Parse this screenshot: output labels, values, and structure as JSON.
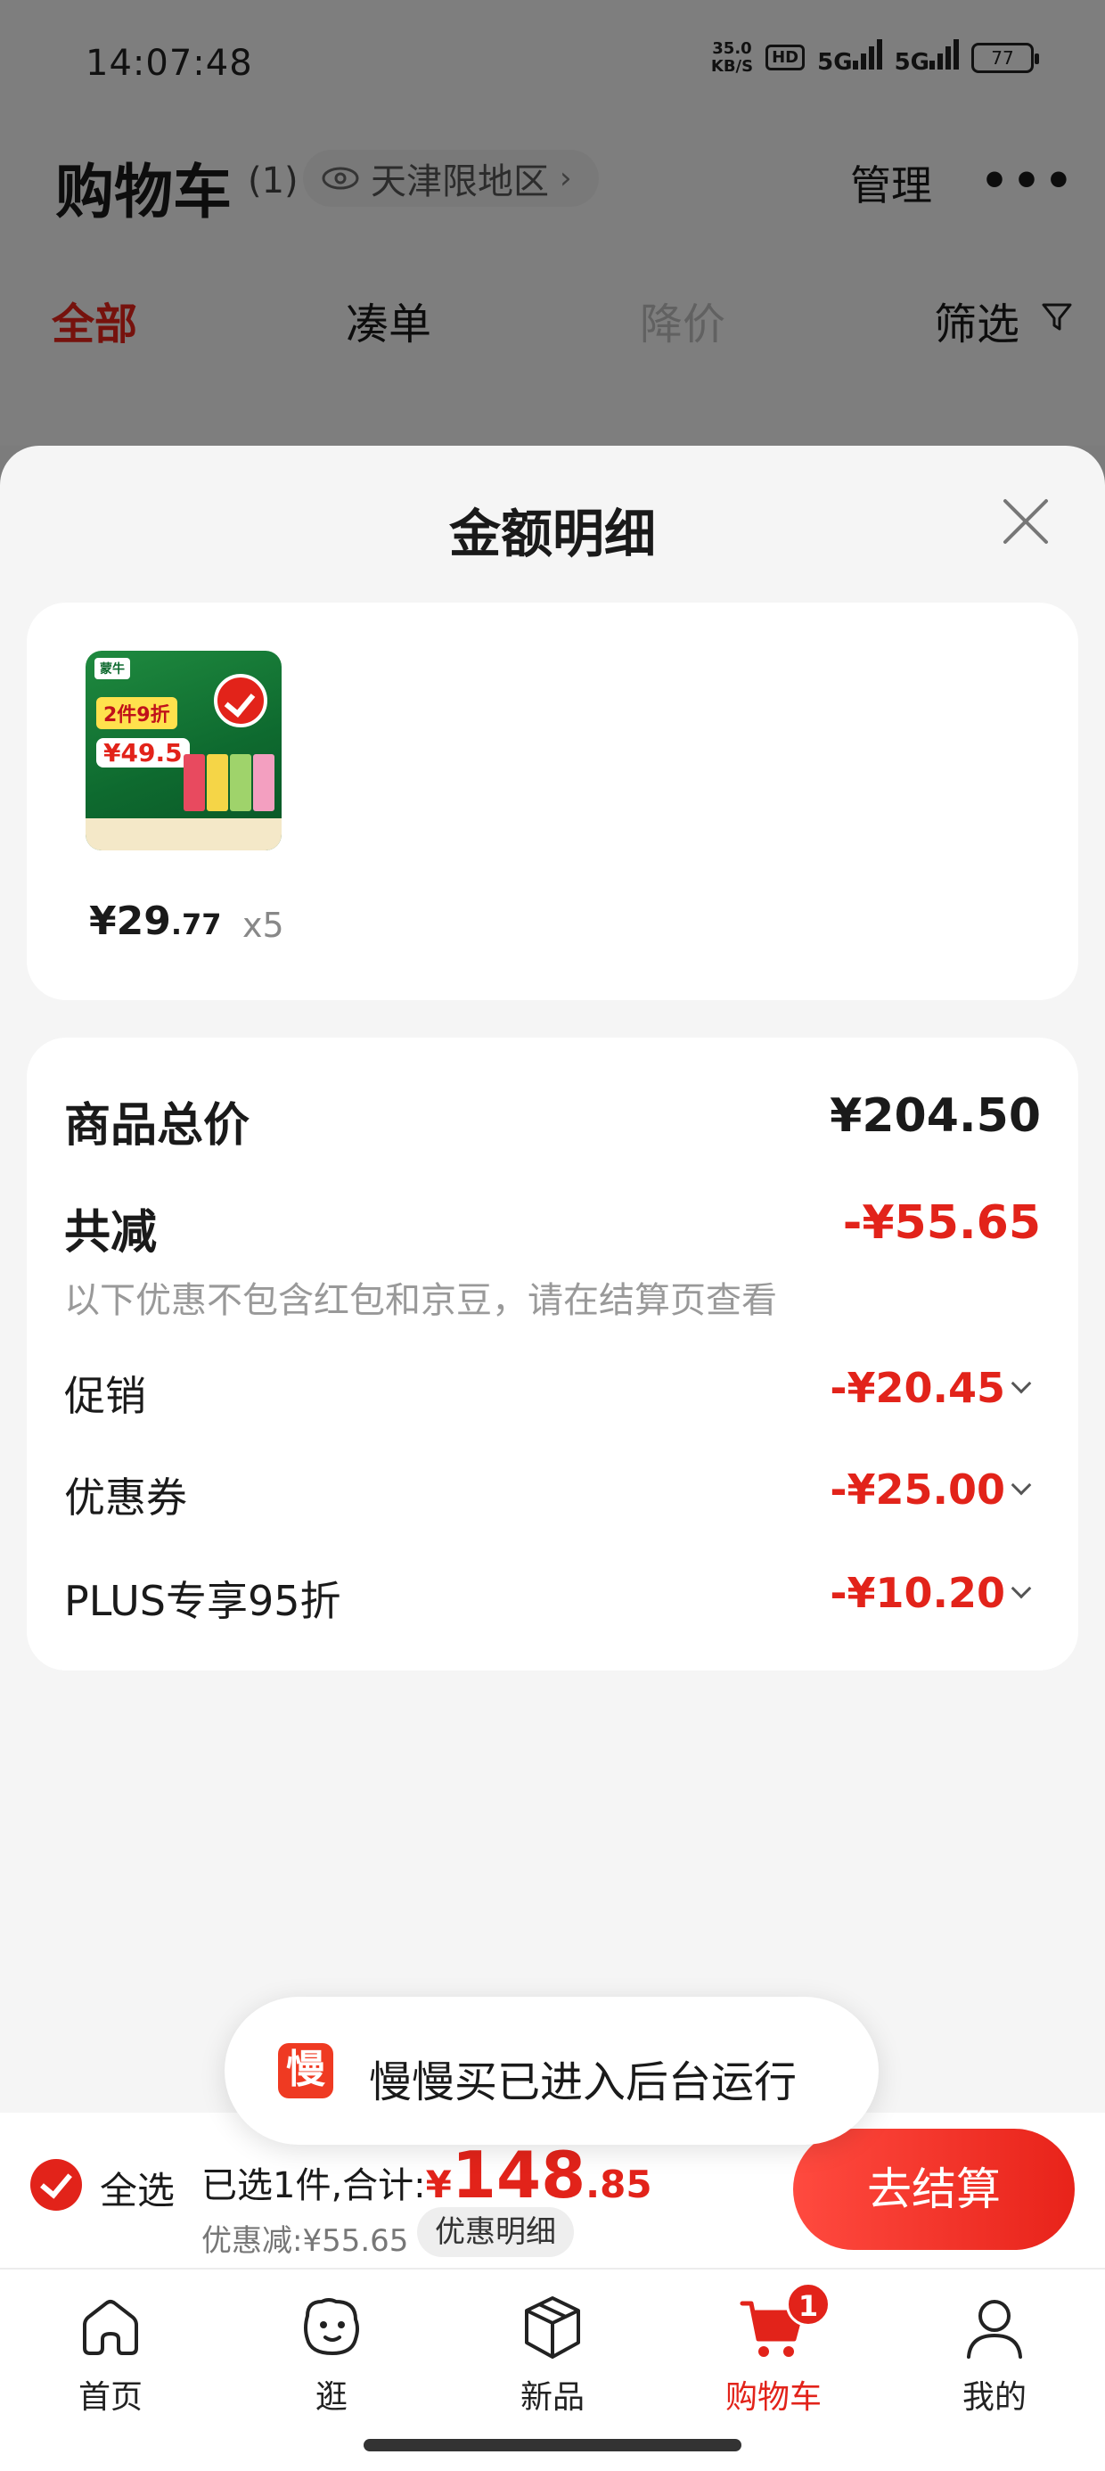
{
  "status_bar": {
    "time": "14:07:48",
    "net_speed_value": "35.0",
    "net_speed_unit": "KB/S",
    "hd_label": "HD",
    "sig1": "5G",
    "sig2": "5G",
    "battery": "77"
  },
  "cart_header": {
    "title": "购物车",
    "count": "(1)",
    "region": "天津限地区",
    "manage": "管理",
    "more": "•••"
  },
  "tabs": [
    {
      "label": "全部",
      "active": true
    },
    {
      "label": "凑单"
    },
    {
      "label": "降价"
    },
    {
      "label": "筛选"
    }
  ],
  "sheet": {
    "title": "金额明细",
    "product": {
      "image_labels": {
        "brand": "蒙牛",
        "deal": "2件9折",
        "price": "¥49.5"
      },
      "price_int": "¥29",
      "price_dec": ".77",
      "qty": "x5"
    },
    "summary": {
      "total_label": "商品总价",
      "total_value": "¥204.50",
      "reduce_label": "共减",
      "reduce_value": "-¥55.65",
      "note": "以下优惠不包含红包和京豆，请在结算页查看",
      "items": [
        {
          "label": "促销",
          "value": "-¥20.45"
        },
        {
          "label": "优惠券",
          "value": "-¥25.00"
        },
        {
          "label": "PLUS专享95折",
          "value": "-¥10.20"
        }
      ]
    }
  },
  "toast": {
    "icon_char": "慢",
    "text": "慢慢买已进入后台运行"
  },
  "checkout": {
    "select_all": "全选",
    "selected_text": "已选1件,合计:",
    "yen": "¥",
    "total_int": "148",
    "total_dec": ".85",
    "save_text": "优惠减:¥55.65",
    "detail_button": "优惠明细",
    "checkout_button": "去结算"
  },
  "nav": {
    "items": [
      {
        "label": "首页",
        "icon": "home-icon"
      },
      {
        "label": "逛",
        "icon": "browse-face-icon"
      },
      {
        "label": "新品",
        "icon": "cube-icon"
      },
      {
        "label": "购物车",
        "icon": "cart-icon",
        "badge": "1",
        "active": true
      },
      {
        "label": "我的",
        "icon": "user-icon"
      }
    ]
  },
  "colors": {
    "accent": "#e2231a",
    "sheet_bg": "#f5f5f5",
    "card_bg": "#ffffff"
  }
}
